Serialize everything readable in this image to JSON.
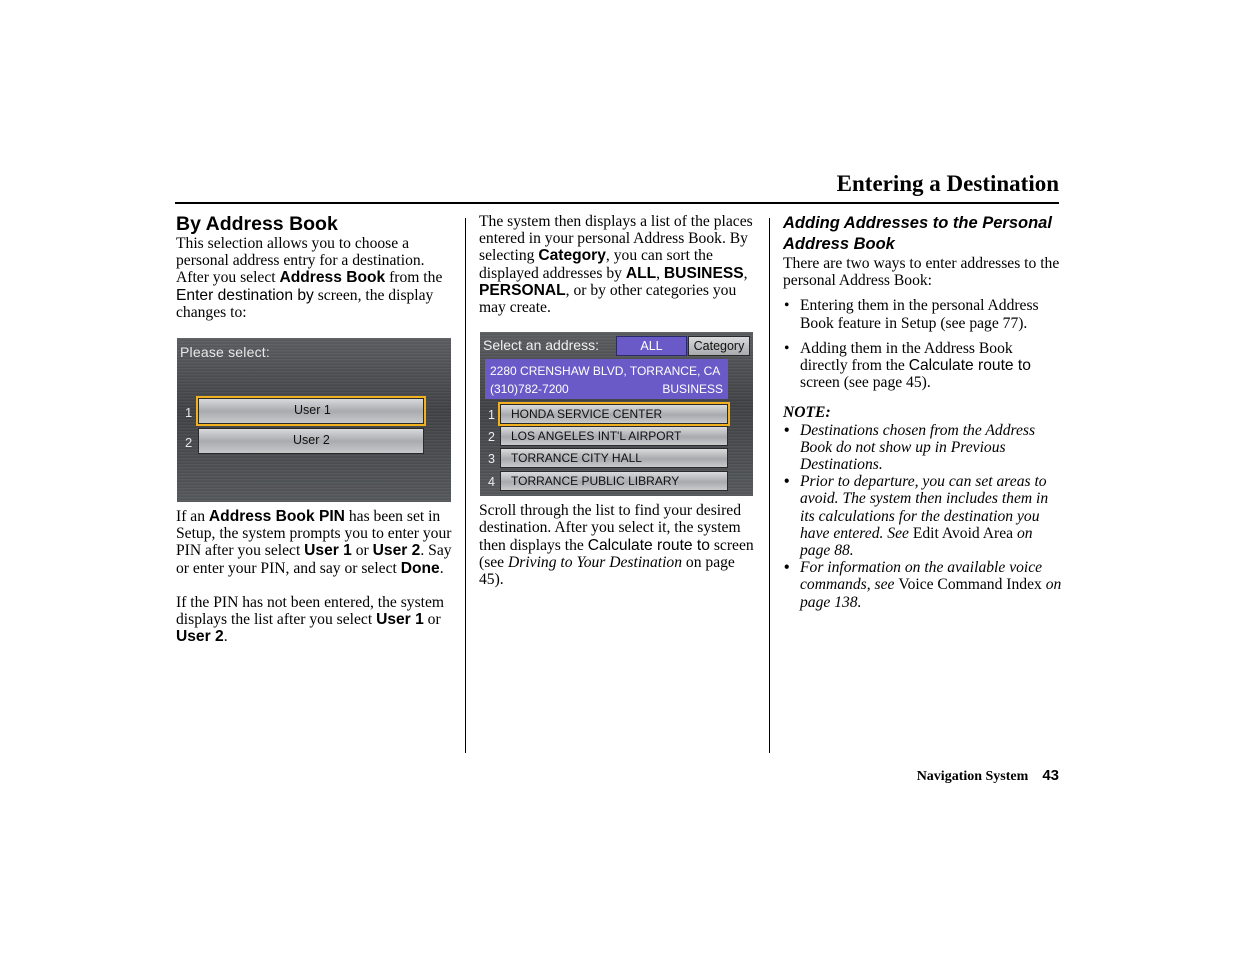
{
  "header": {
    "title": "Entering a Destination"
  },
  "col1": {
    "heading": "By Address Book",
    "intro": {
      "t1": "This selection allows you to choose a personal address entry for a destination. After you select ",
      "b1": "Address Book",
      "t2": " from the ",
      "ui1": "Enter destination by",
      "t3": " screen, the display changes to:"
    },
    "screen": {
      "title": "Please select:",
      "options": [
        {
          "num": "1",
          "label": "User 1",
          "selected": true
        },
        {
          "num": "2",
          "label": "User 2",
          "selected": false
        }
      ]
    },
    "pin_para": {
      "t1": "If an ",
      "b1": "Address Book PIN",
      "t2": " has been set in Setup, the system prompts you to enter your PIN after you select ",
      "b2": "User 1",
      "t3": " or ",
      "b3": "User 2",
      "t4": ". Say or enter your PIN, and say or select ",
      "b4": "Done",
      "t5": "."
    },
    "nopin_para": {
      "t1": "If the PIN has not been entered, the system displays the list after you select ",
      "b1": "User 1",
      "t2": " or ",
      "b2": "User 2",
      "t3": "."
    }
  },
  "col2": {
    "para1": {
      "t1": "The system then displays a list of the places entered in your personal Address Book. By selecting ",
      "b1": "Category",
      "t2": ", you can sort the displayed addresses by ",
      "b2": "ALL",
      "t3": ", ",
      "b3": "BUSINESS",
      "t4": ", ",
      "b4": "PERSONAL",
      "t5": ", or by other categories you may create."
    },
    "screen": {
      "title": "Select an address:",
      "tab_all": "ALL",
      "tab_category": "Category",
      "info_address": "2280 CRENSHAW BLVD, TORRANCE, CA",
      "info_phone": "(310)782-7200",
      "info_category": "BUSINESS",
      "items": [
        {
          "num": "1",
          "label": "HONDA SERVICE CENTER",
          "selected": true
        },
        {
          "num": "2",
          "label": "LOS ANGELES INT'L AIRPORT",
          "selected": false
        },
        {
          "num": "3",
          "label": "TORRANCE CITY HALL",
          "selected": false
        },
        {
          "num": "4",
          "label": "TORRANCE PUBLIC LIBRARY",
          "selected": false
        }
      ]
    },
    "para2": {
      "t1": "Scroll through the list to find your desired destination. After you select it, the system then displays the ",
      "ui1": "Calculate route to",
      "t2": " screen (see ",
      "i1": "Driving to Your Destination",
      "t3": " on page 45)."
    }
  },
  "col3": {
    "heading": "Adding Addresses to the Personal Address Book",
    "intro": "There are two ways to enter addresses to the personal Address Book:",
    "bullets": [
      {
        "t1": "Entering them in the personal Address Book feature in Setup (see page 77)."
      },
      {
        "t1": "Adding them in the Address Book directly from the ",
        "ui1": "Calculate route to",
        "t2": " screen (see page 45)."
      }
    ],
    "note_label": "NOTE:",
    "notes": [
      {
        "i1": "Destinations chosen from the Address Book do not show up in Previous Destinations."
      },
      {
        "i1": "Prior to departure, you can set areas to avoid. The system then includes them in its calculations for the destination you have entered. See ",
        "r1": "Edit Avoid Area",
        "i2": " on page 88."
      },
      {
        "i1": "For information on the available voice commands, see ",
        "r1": "Voice Command Index",
        "i2": " on page 138."
      }
    ],
    "bullet_glyph": "•"
  },
  "footer": {
    "label": "Navigation System",
    "page": "43"
  },
  "colors": {
    "highlight": "#6a5ac8",
    "selection_outline": "#f0b020"
  }
}
